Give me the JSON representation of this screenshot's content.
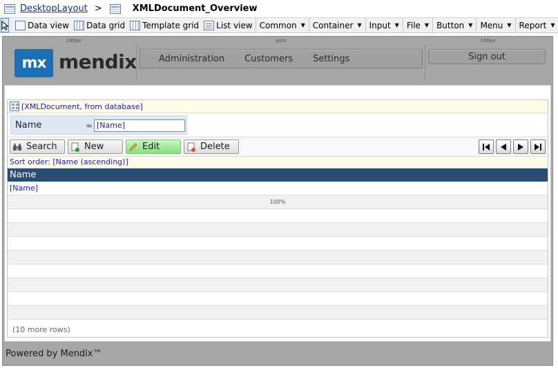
{
  "breadcrumb": {
    "layout_link": "DesktopLayout",
    "separator": ">",
    "current_page": "XMLDocument_Overview"
  },
  "toolbar": {
    "views": [
      {
        "label": "Data view",
        "icon": "data-view-icon"
      },
      {
        "label": "Data grid",
        "icon": "data-grid-icon"
      },
      {
        "label": "Template grid",
        "icon": "template-grid-icon"
      },
      {
        "label": "List view",
        "icon": "list-view-icon"
      }
    ],
    "menus": [
      "Common",
      "Container",
      "Input",
      "File",
      "Button",
      "Menu",
      "Report"
    ]
  },
  "layout": {
    "column_widths": [
      "180px",
      "auto",
      "180px"
    ],
    "logo_badge": "mx",
    "logo_text": "mendix",
    "nav": [
      "Administration",
      "Customers",
      "Settings"
    ],
    "signout_label": "Sign out",
    "footer": "Powered by Mendix™"
  },
  "grid": {
    "title": "[XMLDocument, from database]",
    "search_label": "Name",
    "search_operator": "≈",
    "search_value": "[Name]",
    "buttons": {
      "search": "Search",
      "new": "New",
      "edit": "Edit",
      "delete": "Delete"
    },
    "sort_order": "Sort order: [Name (ascending)]",
    "column_header": "Name",
    "first_row_value": "[Name]",
    "width_indicator": "100%",
    "more_rows": "(10 more rows)"
  },
  "colors": {
    "header_row_bg": "#2a4d73",
    "edit_button_bg": "#86e07d",
    "logo_bg": "#1d6fb4",
    "link_blue": "#1a1ad0"
  }
}
